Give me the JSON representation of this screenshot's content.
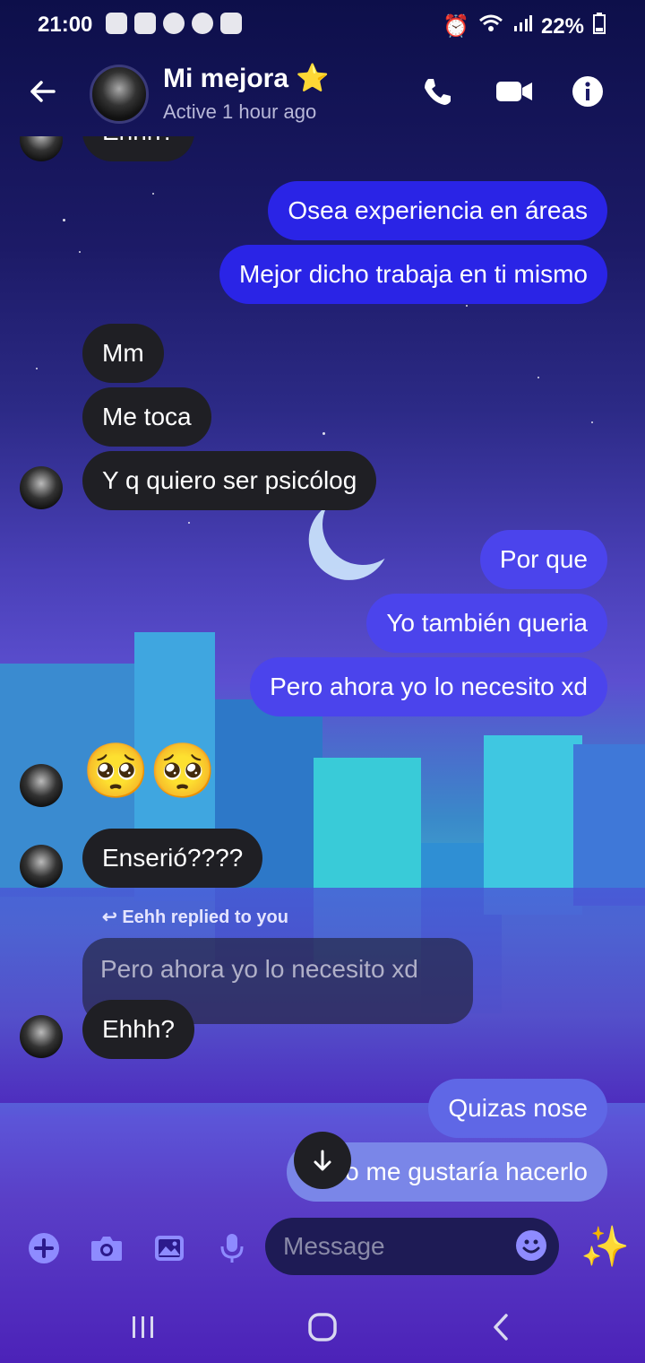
{
  "status_bar": {
    "time": "21:00",
    "battery": "22%"
  },
  "header": {
    "title": "Mi mejora",
    "title_emoji": "⭐",
    "subtitle": "Active 1 hour ago"
  },
  "messages": [
    {
      "id": "m0",
      "text": "Ehhh?",
      "dir": "in"
    },
    {
      "id": "m1",
      "text": "Osea experiencia en áreas",
      "dir": "out"
    },
    {
      "id": "m2",
      "text": "Mejor dicho trabaja en ti mismo",
      "dir": "out"
    },
    {
      "id": "m3",
      "text": "Mm",
      "dir": "in"
    },
    {
      "id": "m4",
      "text": "Me toca",
      "dir": "in"
    },
    {
      "id": "m5",
      "text": "Y q quiero ser psicólog",
      "dir": "in"
    },
    {
      "id": "m6",
      "text": "Por que",
      "dir": "out"
    },
    {
      "id": "m7",
      "text": "Yo también queria",
      "dir": "out"
    },
    {
      "id": "m8",
      "text": "Pero ahora yo lo necesito xd",
      "dir": "out"
    },
    {
      "id": "m9",
      "text": "🥺🥺",
      "dir": "in"
    },
    {
      "id": "m10",
      "text": "Enserió????",
      "dir": "in"
    },
    {
      "id": "m11",
      "text": "Ehhh?",
      "dir": "in"
    },
    {
      "id": "m12",
      "text": "Quizas nose",
      "dir": "out"
    },
    {
      "id": "m13",
      "text": "Pero me gustaría hacerlo",
      "dir": "out"
    }
  ],
  "reply": {
    "label": "Eehh replied to you",
    "quoted": "Pero ahora yo lo necesito xd"
  },
  "composer": {
    "placeholder": "Message",
    "sparkle": "✨"
  },
  "colors": {
    "incoming": "#1f1f24",
    "outgoing": "#2a24e6",
    "accent": "#8e8bff"
  }
}
